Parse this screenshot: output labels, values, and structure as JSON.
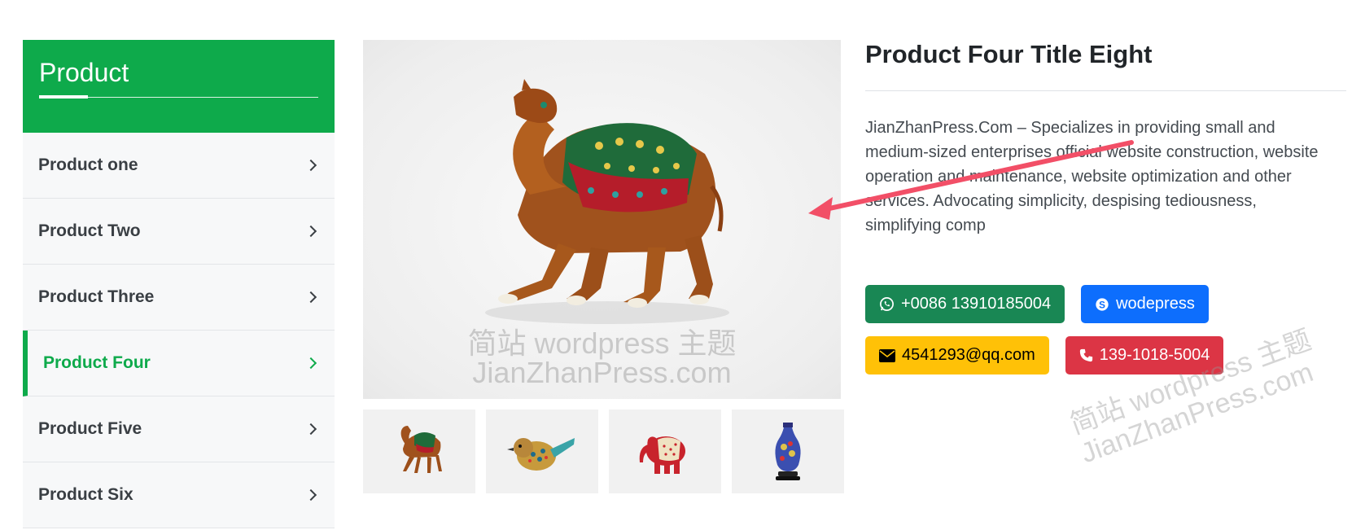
{
  "sidebar": {
    "title": "Product",
    "items": [
      {
        "label": "Product one",
        "active": false
      },
      {
        "label": "Product Two",
        "active": false
      },
      {
        "label": "Product Three",
        "active": false
      },
      {
        "label": "Product Four",
        "active": true
      },
      {
        "label": "Product Five",
        "active": false
      },
      {
        "label": "Product Six",
        "active": false
      }
    ]
  },
  "gallery": {
    "watermark_line1": "简站 wordpress 主题",
    "watermark_line2": "JianZhanPress.com",
    "thumbnails": [
      "camel",
      "bird",
      "elephant",
      "vase"
    ]
  },
  "product": {
    "title": "Product Four Title Eight",
    "description": "JianZhanPress.Com – Specializes in providing small and medium-sized enterprises official website construction, website operation and maintenance, website optimization and other services. Advocating simplicity, despising tediousness, simplifying comp"
  },
  "contacts": {
    "whatsapp": "+0086 13910185004",
    "skype": "wodepress",
    "email": "4541293@qq.com",
    "phone": "139-1018-5004"
  },
  "watermark_right": {
    "line1": "简站 wordpress 主题",
    "line2": "JianZhanPress.com"
  },
  "colors": {
    "accent": "#0eaa4b",
    "whatsapp": "#198754",
    "skype": "#0d6efd",
    "email": "#ffc107",
    "phone": "#dc3545",
    "annotation_arrow": "#f24f67"
  }
}
